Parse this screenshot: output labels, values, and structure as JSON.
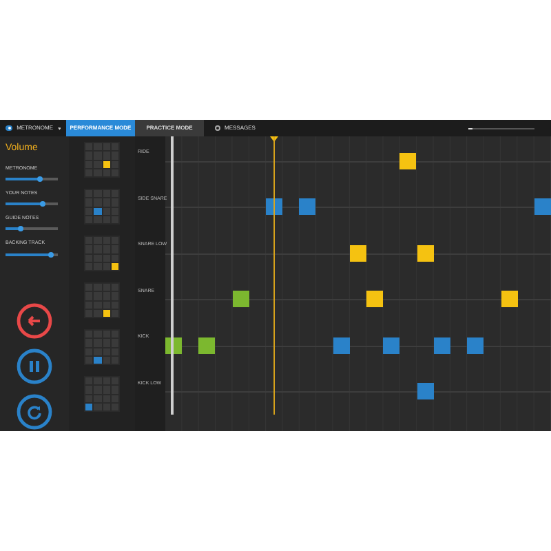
{
  "top_bar": {
    "metronome": {
      "label": "METRONOME",
      "on": true
    },
    "tabs": [
      {
        "label": "PERFORMANCE MODE",
        "selected": true
      },
      {
        "label": "PRACTICE MODE",
        "selected": false
      }
    ],
    "messages": {
      "label": "MESSAGES"
    },
    "progress": {
      "level": 0.06
    }
  },
  "volume": {
    "title": "Volume",
    "sliders": [
      {
        "label": "METRONOME",
        "level": 0.65
      },
      {
        "label": "YOUR NOTES",
        "level": 0.72
      },
      {
        "label": "GUIDE NOTES",
        "level": 0.3
      },
      {
        "label": "BACKING TRACK",
        "level": 0.88
      }
    ]
  },
  "controls": [
    {
      "kind": "back"
    },
    {
      "kind": "pause"
    },
    {
      "kind": "restart"
    }
  ],
  "patterns": [
    {
      "cells": [
        {
          "on": false
        },
        {
          "on": false
        },
        {
          "on": false
        },
        {
          "on": false
        },
        {
          "on": false
        },
        {
          "on": false
        },
        {
          "on": false
        },
        {
          "on": false
        },
        {
          "on": false
        },
        {
          "on": false
        },
        {
          "on": true,
          "color": "#f5c211"
        },
        {
          "on": false
        },
        {
          "on": false
        },
        {
          "on": false
        },
        {
          "on": false
        },
        {
          "on": false
        }
      ]
    },
    {
      "cells": [
        {
          "on": false
        },
        {
          "on": false
        },
        {
          "on": false
        },
        {
          "on": false
        },
        {
          "on": false
        },
        {
          "on": false
        },
        {
          "on": false
        },
        {
          "on": false
        },
        {
          "on": false
        },
        {
          "on": true,
          "color": "#2a82c9"
        },
        {
          "on": false
        },
        {
          "on": false
        },
        {
          "on": false
        },
        {
          "on": false
        },
        {
          "on": false
        },
        {
          "on": false
        }
      ]
    },
    {
      "cells": [
        {
          "on": false
        },
        {
          "on": false
        },
        {
          "on": false
        },
        {
          "on": false
        },
        {
          "on": false
        },
        {
          "on": false
        },
        {
          "on": false
        },
        {
          "on": false
        },
        {
          "on": false
        },
        {
          "on": false
        },
        {
          "on": false
        },
        {
          "on": false
        },
        {
          "on": false
        },
        {
          "on": false
        },
        {
          "on": false
        },
        {
          "on": true,
          "color": "#f5c211"
        }
      ]
    },
    {
      "cells": [
        {
          "on": false
        },
        {
          "on": false
        },
        {
          "on": false
        },
        {
          "on": false
        },
        {
          "on": false
        },
        {
          "on": false
        },
        {
          "on": false
        },
        {
          "on": false
        },
        {
          "on": false
        },
        {
          "on": false
        },
        {
          "on": false
        },
        {
          "on": false
        },
        {
          "on": false
        },
        {
          "on": false
        },
        {
          "on": true,
          "color": "#f5c211"
        },
        {
          "on": false
        }
      ]
    },
    {
      "cells": [
        {
          "on": false
        },
        {
          "on": false
        },
        {
          "on": false
        },
        {
          "on": false
        },
        {
          "on": false
        },
        {
          "on": false
        },
        {
          "on": false
        },
        {
          "on": false
        },
        {
          "on": false
        },
        {
          "on": false
        },
        {
          "on": false
        },
        {
          "on": false
        },
        {
          "on": false
        },
        {
          "on": true,
          "color": "#2a82c9"
        },
        {
          "on": false
        },
        {
          "on": false
        }
      ]
    },
    {
      "cells": [
        {
          "on": false
        },
        {
          "on": false
        },
        {
          "on": false
        },
        {
          "on": false
        },
        {
          "on": false
        },
        {
          "on": false
        },
        {
          "on": false
        },
        {
          "on": false
        },
        {
          "on": false
        },
        {
          "on": false
        },
        {
          "on": false
        },
        {
          "on": false
        },
        {
          "on": true,
          "color": "#2a82c9"
        },
        {
          "on": false
        },
        {
          "on": false
        },
        {
          "on": false
        }
      ]
    }
  ],
  "sequencer": {
    "rows": [
      {
        "label": "RIDE",
        "steps": [
          {
            "on": false
          },
          {
            "on": false
          },
          {
            "on": false
          },
          {
            "on": false
          },
          {
            "on": false
          },
          {
            "on": false
          },
          {
            "on": false
          },
          {
            "on": false
          },
          {
            "on": false
          },
          {
            "on": false
          },
          {
            "on": false
          },
          {
            "on": false
          },
          {
            "on": false
          },
          {
            "on": false
          },
          {
            "on": true,
            "color": "#f5c211"
          },
          {
            "on": false
          },
          {
            "on": false
          },
          {
            "on": false
          },
          {
            "on": false
          },
          {
            "on": false
          },
          {
            "on": false
          },
          {
            "on": false
          },
          {
            "on": false
          }
        ]
      },
      {
        "label": "SIDE SNARE",
        "steps": [
          {
            "on": false
          },
          {
            "on": false
          },
          {
            "on": false
          },
          {
            "on": false
          },
          {
            "on": false
          },
          {
            "on": false
          },
          {
            "on": true,
            "color": "#2a82c9"
          },
          {
            "on": false
          },
          {
            "on": true,
            "color": "#2a82c9"
          },
          {
            "on": false
          },
          {
            "on": false
          },
          {
            "on": false
          },
          {
            "on": false
          },
          {
            "on": false
          },
          {
            "on": false
          },
          {
            "on": false
          },
          {
            "on": false
          },
          {
            "on": false
          },
          {
            "on": false
          },
          {
            "on": false
          },
          {
            "on": false
          },
          {
            "on": false
          },
          {
            "on": true,
            "color": "#2a82c9"
          }
        ]
      },
      {
        "label": "SNARE LOW",
        "steps": [
          {
            "on": false
          },
          {
            "on": false
          },
          {
            "on": false
          },
          {
            "on": false
          },
          {
            "on": false
          },
          {
            "on": false
          },
          {
            "on": false
          },
          {
            "on": false
          },
          {
            "on": false
          },
          {
            "on": false
          },
          {
            "on": false
          },
          {
            "on": true,
            "color": "#f5c211"
          },
          {
            "on": false
          },
          {
            "on": false
          },
          {
            "on": false
          },
          {
            "on": true,
            "color": "#f5c211"
          },
          {
            "on": false
          },
          {
            "on": false
          },
          {
            "on": false
          },
          {
            "on": false
          },
          {
            "on": false
          },
          {
            "on": false
          },
          {
            "on": false
          }
        ]
      },
      {
        "label": "SNARE",
        "steps": [
          {
            "on": false
          },
          {
            "on": false
          },
          {
            "on": false
          },
          {
            "on": false
          },
          {
            "on": true,
            "color": "#7cb82f"
          },
          {
            "on": false
          },
          {
            "on": false
          },
          {
            "on": false
          },
          {
            "on": false
          },
          {
            "on": false
          },
          {
            "on": false
          },
          {
            "on": false
          },
          {
            "on": true,
            "color": "#f5c211"
          },
          {
            "on": false
          },
          {
            "on": false
          },
          {
            "on": false
          },
          {
            "on": false
          },
          {
            "on": false
          },
          {
            "on": false
          },
          {
            "on": false
          },
          {
            "on": true,
            "color": "#f5c211"
          },
          {
            "on": false
          },
          {
            "on": false
          }
        ]
      },
      {
        "label": "KICK",
        "steps": [
          {
            "on": true,
            "color": "#7cb82f"
          },
          {
            "on": false
          },
          {
            "on": true,
            "color": "#7cb82f"
          },
          {
            "on": false
          },
          {
            "on": false
          },
          {
            "on": false
          },
          {
            "on": false
          },
          {
            "on": false
          },
          {
            "on": false
          },
          {
            "on": false
          },
          {
            "on": true,
            "color": "#2a82c9"
          },
          {
            "on": false
          },
          {
            "on": false
          },
          {
            "on": true,
            "color": "#2a82c9"
          },
          {
            "on": false
          },
          {
            "on": false
          },
          {
            "on": true,
            "color": "#2a82c9"
          },
          {
            "on": false
          },
          {
            "on": true,
            "color": "#2a82c9"
          },
          {
            "on": false
          },
          {
            "on": false
          },
          {
            "on": false
          },
          {
            "on": false
          }
        ]
      },
      {
        "label": "KICK LOW",
        "steps": [
          {
            "on": false
          },
          {
            "on": false
          },
          {
            "on": false
          },
          {
            "on": false
          },
          {
            "on": false
          },
          {
            "on": false
          },
          {
            "on": false
          },
          {
            "on": false
          },
          {
            "on": false
          },
          {
            "on": false
          },
          {
            "on": false
          },
          {
            "on": false
          },
          {
            "on": false
          },
          {
            "on": false
          },
          {
            "on": false
          },
          {
            "on": true,
            "color": "#2a82c9"
          },
          {
            "on": false
          },
          {
            "on": false
          },
          {
            "on": false
          },
          {
            "on": false
          },
          {
            "on": false
          },
          {
            "on": false
          },
          {
            "on": false
          }
        ]
      }
    ]
  }
}
